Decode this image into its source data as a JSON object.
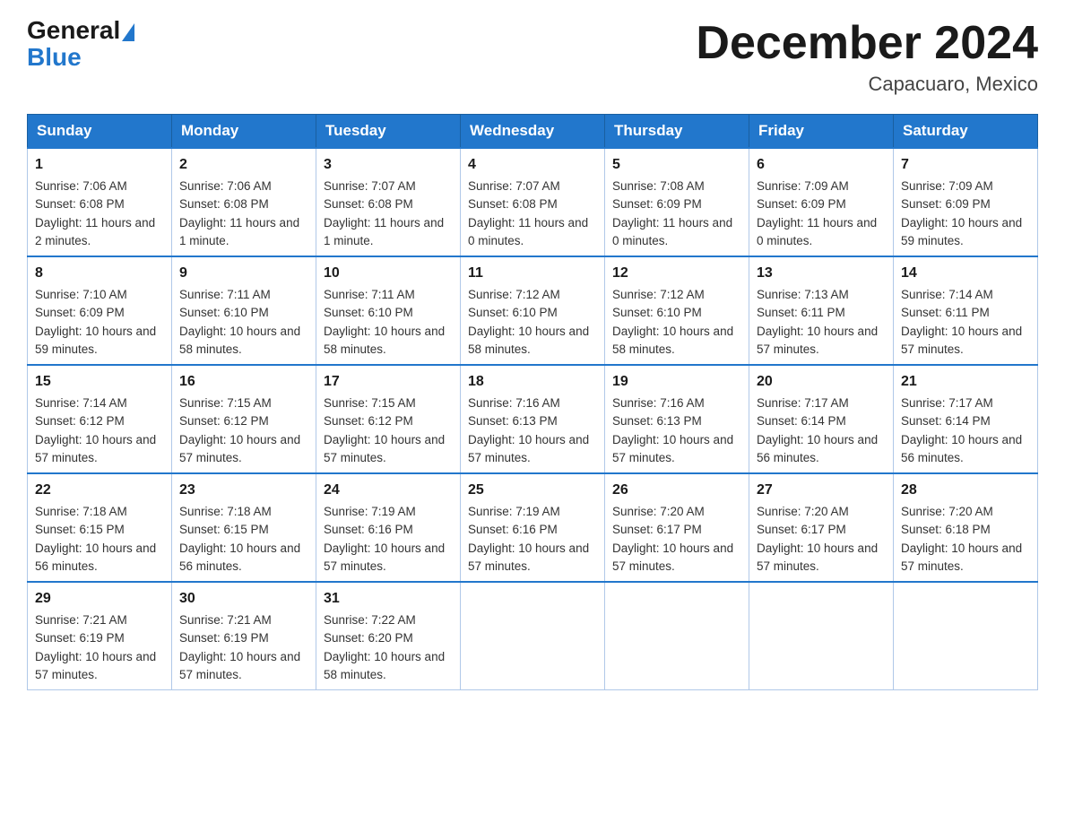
{
  "logo": {
    "general": "General",
    "blue": "Blue"
  },
  "title": "December 2024",
  "location": "Capacuaro, Mexico",
  "days_header": [
    "Sunday",
    "Monday",
    "Tuesday",
    "Wednesday",
    "Thursday",
    "Friday",
    "Saturday"
  ],
  "weeks": [
    [
      {
        "day": "1",
        "sunrise": "7:06 AM",
        "sunset": "6:08 PM",
        "daylight": "11 hours and 2 minutes."
      },
      {
        "day": "2",
        "sunrise": "7:06 AM",
        "sunset": "6:08 PM",
        "daylight": "11 hours and 1 minute."
      },
      {
        "day": "3",
        "sunrise": "7:07 AM",
        "sunset": "6:08 PM",
        "daylight": "11 hours and 1 minute."
      },
      {
        "day": "4",
        "sunrise": "7:07 AM",
        "sunset": "6:08 PM",
        "daylight": "11 hours and 0 minutes."
      },
      {
        "day": "5",
        "sunrise": "7:08 AM",
        "sunset": "6:09 PM",
        "daylight": "11 hours and 0 minutes."
      },
      {
        "day": "6",
        "sunrise": "7:09 AM",
        "sunset": "6:09 PM",
        "daylight": "11 hours and 0 minutes."
      },
      {
        "day": "7",
        "sunrise": "7:09 AM",
        "sunset": "6:09 PM",
        "daylight": "10 hours and 59 minutes."
      }
    ],
    [
      {
        "day": "8",
        "sunrise": "7:10 AM",
        "sunset": "6:09 PM",
        "daylight": "10 hours and 59 minutes."
      },
      {
        "day": "9",
        "sunrise": "7:11 AM",
        "sunset": "6:10 PM",
        "daylight": "10 hours and 58 minutes."
      },
      {
        "day": "10",
        "sunrise": "7:11 AM",
        "sunset": "6:10 PM",
        "daylight": "10 hours and 58 minutes."
      },
      {
        "day": "11",
        "sunrise": "7:12 AM",
        "sunset": "6:10 PM",
        "daylight": "10 hours and 58 minutes."
      },
      {
        "day": "12",
        "sunrise": "7:12 AM",
        "sunset": "6:10 PM",
        "daylight": "10 hours and 58 minutes."
      },
      {
        "day": "13",
        "sunrise": "7:13 AM",
        "sunset": "6:11 PM",
        "daylight": "10 hours and 57 minutes."
      },
      {
        "day": "14",
        "sunrise": "7:14 AM",
        "sunset": "6:11 PM",
        "daylight": "10 hours and 57 minutes."
      }
    ],
    [
      {
        "day": "15",
        "sunrise": "7:14 AM",
        "sunset": "6:12 PM",
        "daylight": "10 hours and 57 minutes."
      },
      {
        "day": "16",
        "sunrise": "7:15 AM",
        "sunset": "6:12 PM",
        "daylight": "10 hours and 57 minutes."
      },
      {
        "day": "17",
        "sunrise": "7:15 AM",
        "sunset": "6:12 PM",
        "daylight": "10 hours and 57 minutes."
      },
      {
        "day": "18",
        "sunrise": "7:16 AM",
        "sunset": "6:13 PM",
        "daylight": "10 hours and 57 minutes."
      },
      {
        "day": "19",
        "sunrise": "7:16 AM",
        "sunset": "6:13 PM",
        "daylight": "10 hours and 57 minutes."
      },
      {
        "day": "20",
        "sunrise": "7:17 AM",
        "sunset": "6:14 PM",
        "daylight": "10 hours and 56 minutes."
      },
      {
        "day": "21",
        "sunrise": "7:17 AM",
        "sunset": "6:14 PM",
        "daylight": "10 hours and 56 minutes."
      }
    ],
    [
      {
        "day": "22",
        "sunrise": "7:18 AM",
        "sunset": "6:15 PM",
        "daylight": "10 hours and 56 minutes."
      },
      {
        "day": "23",
        "sunrise": "7:18 AM",
        "sunset": "6:15 PM",
        "daylight": "10 hours and 56 minutes."
      },
      {
        "day": "24",
        "sunrise": "7:19 AM",
        "sunset": "6:16 PM",
        "daylight": "10 hours and 57 minutes."
      },
      {
        "day": "25",
        "sunrise": "7:19 AM",
        "sunset": "6:16 PM",
        "daylight": "10 hours and 57 minutes."
      },
      {
        "day": "26",
        "sunrise": "7:20 AM",
        "sunset": "6:17 PM",
        "daylight": "10 hours and 57 minutes."
      },
      {
        "day": "27",
        "sunrise": "7:20 AM",
        "sunset": "6:17 PM",
        "daylight": "10 hours and 57 minutes."
      },
      {
        "day": "28",
        "sunrise": "7:20 AM",
        "sunset": "6:18 PM",
        "daylight": "10 hours and 57 minutes."
      }
    ],
    [
      {
        "day": "29",
        "sunrise": "7:21 AM",
        "sunset": "6:19 PM",
        "daylight": "10 hours and 57 minutes."
      },
      {
        "day": "30",
        "sunrise": "7:21 AM",
        "sunset": "6:19 PM",
        "daylight": "10 hours and 57 minutes."
      },
      {
        "day": "31",
        "sunrise": "7:22 AM",
        "sunset": "6:20 PM",
        "daylight": "10 hours and 58 minutes."
      },
      null,
      null,
      null,
      null
    ]
  ]
}
